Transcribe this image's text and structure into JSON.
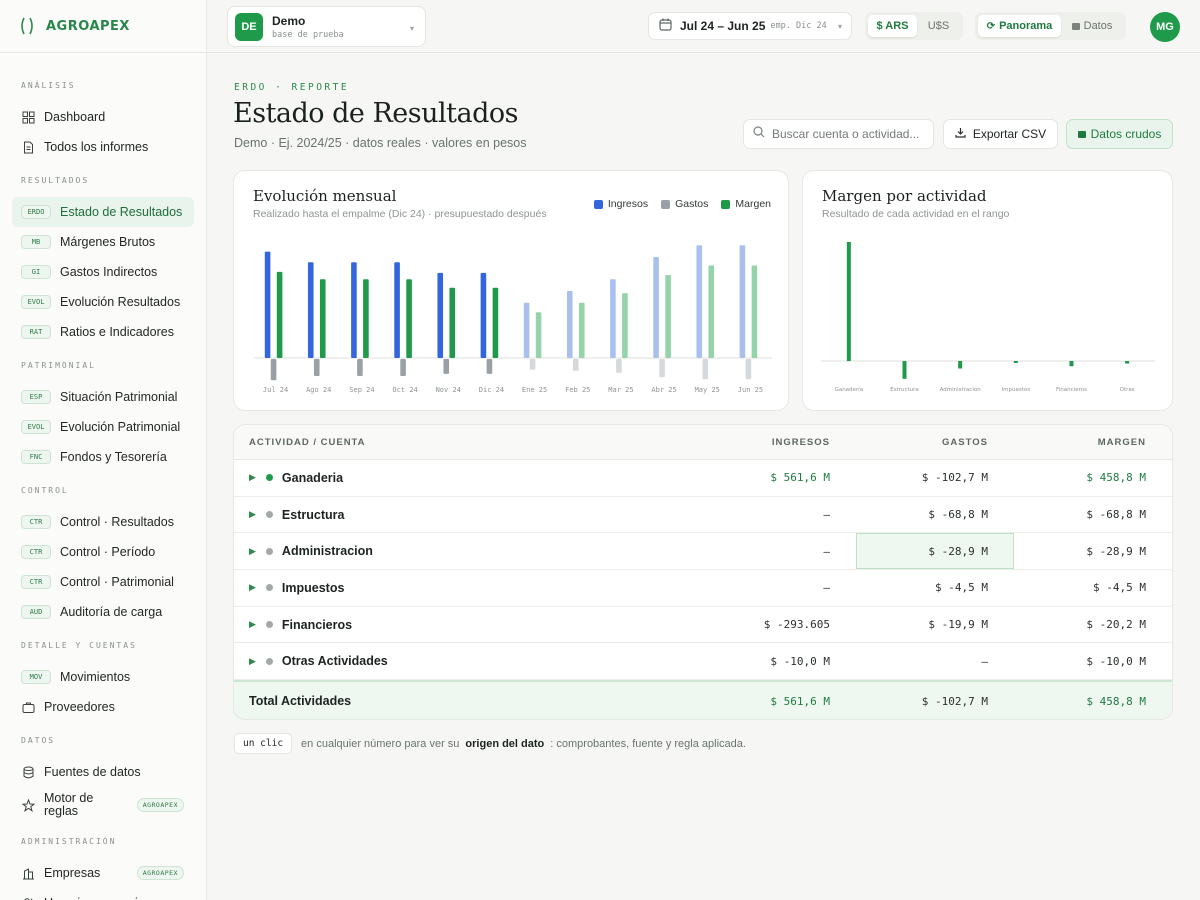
{
  "brand": {
    "name": "AGROAPEX"
  },
  "sidebar": {
    "sections": [
      {
        "title": "ANÁLISIS",
        "items": [
          {
            "label": "Dashboard",
            "icon": "dashboard-icon"
          },
          {
            "label": "Todos los informes",
            "icon": "document-icon"
          }
        ]
      },
      {
        "title": "RESULTADOS",
        "items": [
          {
            "tag": "ERDO",
            "label": "Estado de Resultados",
            "active": true
          },
          {
            "tag": "MB",
            "label": "Márgenes Brutos"
          },
          {
            "tag": "GI",
            "label": "Gastos Indirectos"
          },
          {
            "tag": "EVOL",
            "label": "Evolución Resultados"
          },
          {
            "tag": "RAT",
            "label": "Ratios e Indicadores"
          }
        ]
      },
      {
        "title": "PATRIMONIAL",
        "items": [
          {
            "tag": "ESP",
            "label": "Situación Patrimonial"
          },
          {
            "tag": "EVOL",
            "label": "Evolución Patrimonial"
          },
          {
            "tag": "FNC",
            "label": "Fondos y Tesorería"
          }
        ]
      },
      {
        "title": "CONTROL",
        "items": [
          {
            "tag": "CTR",
            "label": "Control · Resultados"
          },
          {
            "tag": "CTR",
            "label": "Control · Período"
          },
          {
            "tag": "CTR",
            "label": "Control · Patrimonial"
          },
          {
            "tag": "AUD",
            "label": "Auditoría de carga"
          }
        ]
      },
      {
        "title": "DETALLE Y CUENTAS",
        "items": [
          {
            "tag": "MOV",
            "label": "Movimientos"
          },
          {
            "label": "Proveedores",
            "icon": "briefcase-icon"
          }
        ]
      },
      {
        "title": "DATOS",
        "items": [
          {
            "label": "Fuentes de datos",
            "icon": "database-icon"
          },
          {
            "label": "Motor de reglas",
            "icon": "star-icon",
            "badge": "AGROAPEX"
          }
        ]
      },
      {
        "title": "ADMINISTRACIÓN",
        "items": [
          {
            "label": "Empresas",
            "icon": "building-icon",
            "badge": "AGROAPEX"
          },
          {
            "label": "Usuarios y permisos",
            "icon": "users-icon"
          }
        ]
      }
    ]
  },
  "topbar": {
    "company": {
      "initials": "DE",
      "name": "Demo",
      "sub": "base de prueba"
    },
    "daterange": {
      "main": "Jul 24 – Jun 25",
      "emp": "emp. Dic 24"
    },
    "currency": {
      "ars": "$ ARS",
      "usd": "U$S"
    },
    "view": {
      "panorama": "Panorama",
      "datos": "Datos"
    },
    "avatar": "MG"
  },
  "header": {
    "crumb": "ERDO · REPORTE",
    "title": "Estado de Resultados",
    "subtitle": "Demo · Ej. 2024/25 · datos reales · valores en pesos",
    "search_placeholder": "Buscar cuenta o actividad...",
    "export_label": "Exportar CSV",
    "raw_label": "Datos crudos"
  },
  "colors": {
    "ingresos": "#3366dd",
    "gastos": "#9aa1a6",
    "margen": "#1e9a4a",
    "ingresos_budget": "#a9c0ef",
    "gastos_budget": "#d6d9dc",
    "margen_budget": "#95d3aa"
  },
  "chart_data": [
    {
      "type": "bar",
      "title": "Evolución mensual",
      "subtitle": "Realizado hasta el empalme (Dic 24) · presupuestado después",
      "categories": [
        "Jul 24",
        "Ago 24",
        "Sep 24",
        "Oct 24",
        "Nov 24",
        "Dic 24",
        "Ene 25",
        "Feb 25",
        "Mar 25",
        "Abr 25",
        "May 25",
        "Jun 25"
      ],
      "actual_until_index": 5,
      "series": [
        {
          "name": "Ingresos",
          "values": [
            100,
            90,
            90,
            90,
            80,
            80,
            52,
            63,
            74,
            95,
            106,
            106
          ]
        },
        {
          "name": "Gastos",
          "values": [
            -20,
            -16,
            -16,
            -16,
            -14,
            -14,
            -10,
            -11,
            -13,
            -17,
            -19,
            -19
          ]
        },
        {
          "name": "Margen",
          "values": [
            81,
            74,
            74,
            74,
            66,
            66,
            43,
            52,
            61,
            78,
            87,
            87
          ]
        }
      ],
      "ylim": [
        -22,
        110
      ]
    },
    {
      "type": "bar",
      "title": "Margen por actividad",
      "subtitle": "Resultado de cada actividad en el rango",
      "categories": [
        "Ganadería",
        "Estructura",
        "Administracion",
        "Impuestos",
        "Financieros",
        "Otras"
      ],
      "values": [
        458.8,
        -68.8,
        -28.9,
        -4.5,
        -20.2,
        -10.0
      ],
      "ylim": [
        -75,
        470
      ]
    }
  ],
  "table": {
    "headers": {
      "act": "ACTIVIDAD / CUENTA",
      "ing": "INGRESOS",
      "gas": "GASTOS",
      "mar": "MARGEN"
    },
    "rows": [
      {
        "name": "Ganaderia",
        "ing": "$ 561,6 M",
        "gas": "$ -102,7 M",
        "mar": "$ 458,8 M",
        "dot": "#1e9a4a",
        "ing_pos": true,
        "mar_pos": true
      },
      {
        "name": "Estructura",
        "ing": "—",
        "gas": "$ -68,8 M",
        "mar": "$ -68,8 M",
        "dot": "#a3a9a5"
      },
      {
        "name": "Administracion",
        "ing": "—",
        "gas": "$ -28,9 M",
        "mar": "$ -28,9 M",
        "dot": "#a3a9a5",
        "highlight": true
      },
      {
        "name": "Impuestos",
        "ing": "—",
        "gas": "$ -4,5 M",
        "mar": "$ -4,5 M",
        "dot": "#a3a9a5"
      },
      {
        "name": "Financieros",
        "ing": "$ -293.605",
        "gas": "$ -19,9 M",
        "mar": "$ -20,2 M",
        "dot": "#a3a9a5"
      },
      {
        "name": "Otras Actividades",
        "ing": "$ -10,0 M",
        "gas": "—",
        "mar": "$ -10,0 M",
        "dot": "#a3a9a5"
      }
    ],
    "total": {
      "name": "Total Actividades",
      "ing": "$ 561,6 M",
      "gas": "$ -102,7 M",
      "mar": "$ 458,8 M"
    }
  },
  "hint": {
    "kbd": "un clic",
    "pre": "en cualquier número para ver su",
    "bold": "origen del dato",
    "post": ": comprobantes, fuente y regla aplicada."
  }
}
